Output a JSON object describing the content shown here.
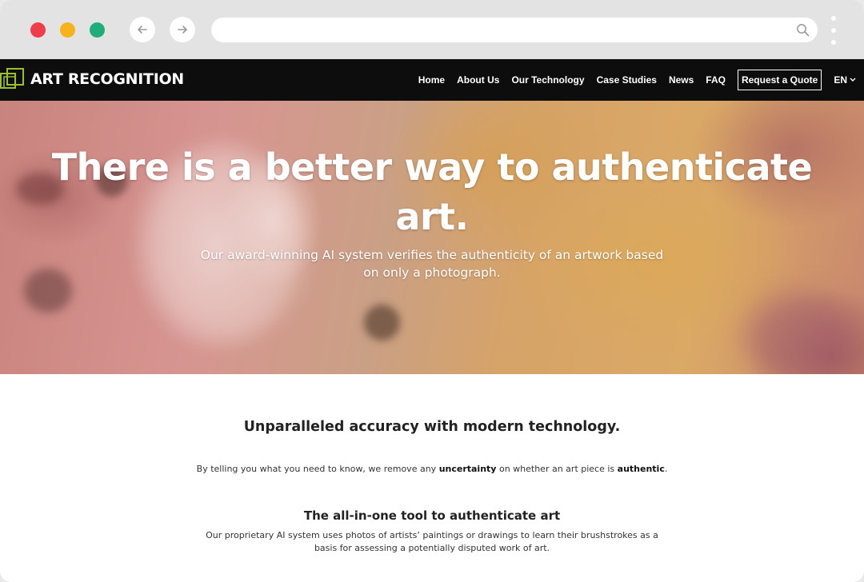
{
  "browser": {
    "icons": {
      "back": "arrow-left-icon",
      "forward": "arrow-right-icon",
      "search": "search-icon",
      "menu": "more-vertical-icon"
    },
    "colors": {
      "close": "#ef3e4a",
      "minimize": "#f6b21b",
      "maximize": "#1fae7a"
    }
  },
  "header": {
    "logo_text": "ART RECOGNITION",
    "nav": {
      "home": "Home",
      "about": "About Us",
      "technology": "Our Technology",
      "case_studies": "Case Studies",
      "news": "News",
      "faq": "FAQ",
      "quote": "Request a Quote",
      "language": "EN"
    }
  },
  "hero": {
    "title": "There is a better way to authenticate art.",
    "subtitle": "Our award-winning AI system verifies the authenticity of an artwork based on only a photograph."
  },
  "accuracy": {
    "heading": "Unparalleled accuracy with modern technology.",
    "text_part1": "By telling you what you need to know, we remove any ",
    "text_bold1": "uncertainty",
    "text_part2": " on whether an art piece is ",
    "text_bold2": "authentic",
    "text_part3": "."
  },
  "tool": {
    "heading": "The all-in-one tool to authenticate art",
    "text": "Our proprietary AI system uses photos of artists’ paintings or drawings to learn their brushstrokes as a basis for assessing a potentially disputed work of art."
  }
}
